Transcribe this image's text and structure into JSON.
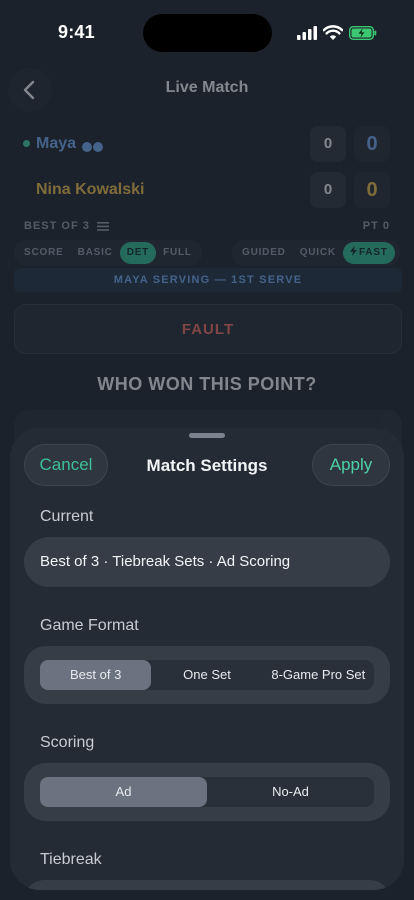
{
  "status": {
    "time": "9:41"
  },
  "nav": {
    "title": "Live Match"
  },
  "players": [
    {
      "name": "Maya",
      "games": "0",
      "points": "0"
    },
    {
      "name": "Nina Kowalski",
      "games": "0",
      "points": "0"
    }
  ],
  "meta": {
    "format": "BEST OF 3",
    "point": "PT 0"
  },
  "detail_modes": [
    {
      "label": "SCORE",
      "active": false
    },
    {
      "label": "BASIC",
      "active": false
    },
    {
      "label": "DET",
      "active": true
    },
    {
      "label": "FULL",
      "active": false
    }
  ],
  "input_modes": [
    {
      "label": "GUIDED",
      "active": false
    },
    {
      "label": "QUICK",
      "active": false
    },
    {
      "label": "FAST",
      "active": true
    }
  ],
  "serving_banner": "MAYA SERVING — 1ST SERVE",
  "fault_label": "FAULT",
  "question": "WHO WON THIS POINT?",
  "sheet": {
    "title": "Match Settings",
    "cancel_label": "Cancel",
    "apply_label": "Apply",
    "current_label": "Current",
    "current_value": "Best of 3 · Tiebreak Sets · Ad Scoring",
    "game_format_label": "Game Format",
    "game_format_options": [
      "Best of 3",
      "One Set",
      "8-Game Pro Set"
    ],
    "game_format_selected": 0,
    "scoring_label": "Scoring",
    "scoring_options": [
      "Ad",
      "No-Ad"
    ],
    "scoring_selected": 0,
    "tiebreak_label": "Tiebreak"
  },
  "colors": {
    "accent": "#4dd0a4",
    "player1": "#6fa3e8",
    "player2": "#e3b54a",
    "fault": "#e4685d"
  }
}
